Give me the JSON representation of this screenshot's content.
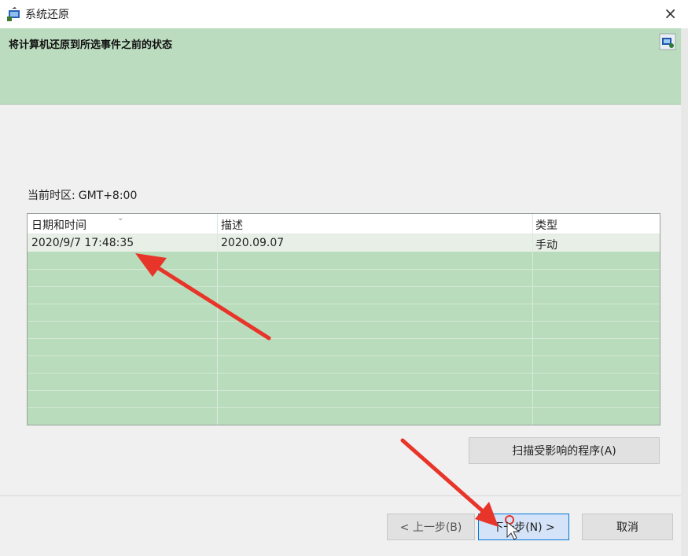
{
  "window": {
    "title": "系统还原",
    "close_glyph": "×"
  },
  "header": {
    "text": "将计算机还原到所选事件之前的状态"
  },
  "timezone": {
    "label": "当前时区:",
    "value": "GMT+8:00"
  },
  "table": {
    "columns": [
      "日期和时间",
      "描述",
      "类型"
    ],
    "rows": [
      {
        "datetime": "2020/9/7 17:48:35",
        "description": "2020.09.07",
        "type": "手动"
      }
    ]
  },
  "buttons": {
    "scan": "扫描受影响的程序(A)",
    "back": "< 上一步(B)",
    "next": "下一步(N) >",
    "cancel": "取消"
  },
  "colors": {
    "header_bg": "#bcdcbf",
    "table_bg": "#b9dcbc",
    "arrow": "#e8352a",
    "accent": "#0078d7"
  },
  "icons": [
    "system-restore-icon",
    "close-icon",
    "wizard-icon",
    "sort-chevron-icon",
    "annotation-arrow",
    "mouse-cursor-icon"
  ]
}
